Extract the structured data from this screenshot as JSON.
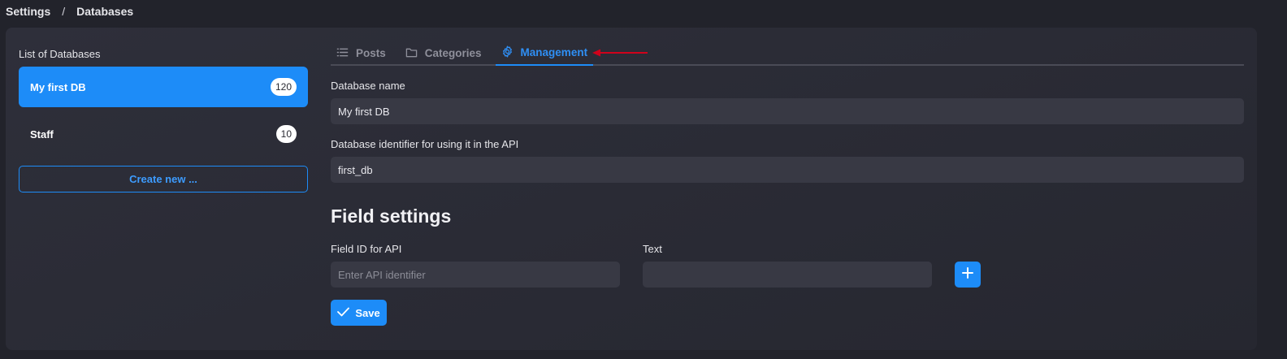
{
  "breadcrumb": {
    "items": [
      "Settings",
      "Databases"
    ],
    "separator": "/"
  },
  "sidebar": {
    "title": "List of Databases",
    "databases": [
      {
        "label": "My first DB",
        "count": "120",
        "active": true
      },
      {
        "label": "Staff",
        "count": "10",
        "active": false
      }
    ],
    "create_label": "Create new ..."
  },
  "tabs": [
    {
      "label": "Posts",
      "icon": "list-icon"
    },
    {
      "label": "Categories",
      "icon": "folder-icon"
    },
    {
      "label": "Management",
      "icon": "gear-icon",
      "active": true
    }
  ],
  "form": {
    "db_name_label": "Database name",
    "db_name_value": "My first DB",
    "db_id_label": "Database identifier for using it in the API",
    "db_id_value": "first_db"
  },
  "field_settings": {
    "heading": "Field settings",
    "field_id_label": "Field ID for API",
    "field_id_placeholder": "Enter API identifier",
    "field_id_value": "",
    "text_label": "Text",
    "text_value": "",
    "add_icon": "plus-icon"
  },
  "save_label": "Save",
  "colors": {
    "accent": "#1d8cf8",
    "annotation_arrow": "#d0021b",
    "background": "#22232b",
    "card": "#2b2c36"
  }
}
